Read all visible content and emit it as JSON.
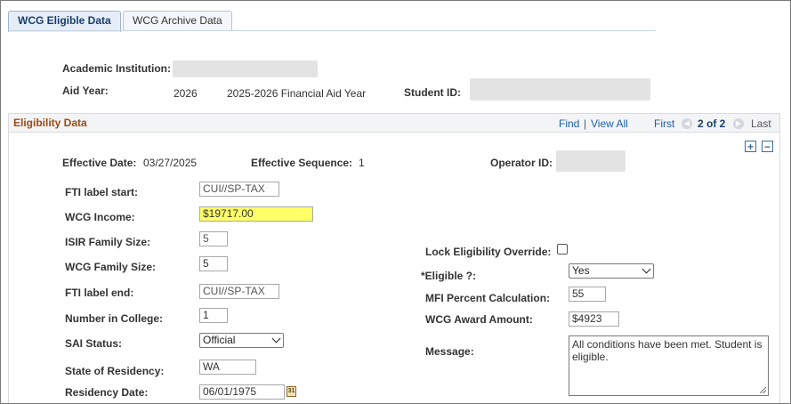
{
  "tabs": [
    {
      "label": "WCG Eligible Data",
      "active": true
    },
    {
      "label": "WCG Archive Data",
      "active": false
    }
  ],
  "header": {
    "academic_institution_label": "Academic Institution:",
    "aid_year_label": "Aid Year:",
    "aid_year_value": "2026",
    "aid_year_description": "2025-2026 Financial Aid Year",
    "student_id_label": "Student ID:"
  },
  "section": {
    "title": "Eligibility Data",
    "find": "Find",
    "separator": "|",
    "view_all": "View All",
    "first": "First",
    "position": "2 of 2",
    "last": "Last",
    "add_row": "+",
    "delete_row": "−"
  },
  "fields": {
    "effective_date_label": "Effective Date:",
    "effective_date_value": "03/27/2025",
    "effective_sequence_label": "Effective Sequence:",
    "effective_sequence_value": "1",
    "operator_id_label": "Operator ID:",
    "fti_label_start_label": "FTI label start:",
    "fti_label_start_value": "CUI//SP-TAX",
    "wcg_income_label": "WCG Income:",
    "wcg_income_value": "$19717.00",
    "isir_family_size_label": "ISIR Family Size:",
    "isir_family_size_value": "5",
    "wcg_family_size_label": "WCG Family Size:",
    "wcg_family_size_value": "5",
    "fti_label_end_label": "FTI label end:",
    "fti_label_end_value": "CUI//SP-TAX",
    "number_in_college_label": "Number in College:",
    "number_in_college_value": "1",
    "sai_status_label": "SAI Status:",
    "sai_status_value": "Official",
    "state_of_residency_label": "State of Residency:",
    "state_of_residency_value": "WA",
    "residency_date_label": "Residency Date:",
    "residency_date_value": "06/01/1975",
    "lock_override_label": "Lock Eligibility Override:",
    "lock_override_checked": false,
    "eligible_label": "*Eligible ?:",
    "eligible_value": "Yes",
    "mfi_percent_label": "MFI Percent Calculation:",
    "mfi_percent_value": "55",
    "wcg_award_label": "WCG Award Amount:",
    "wcg_award_value": "$4923",
    "message_label": "Message:",
    "message_value": "All conditions have been met.  Student is eligible."
  },
  "icons": {
    "calendar": "calendar-icon",
    "first_arrow": "arrow-left-circle-icon",
    "last_arrow": "arrow-right-circle-icon"
  },
  "colors": {
    "section_title": "#9d4b15",
    "link": "#1f5fa8",
    "highlight": "#ffff66"
  }
}
